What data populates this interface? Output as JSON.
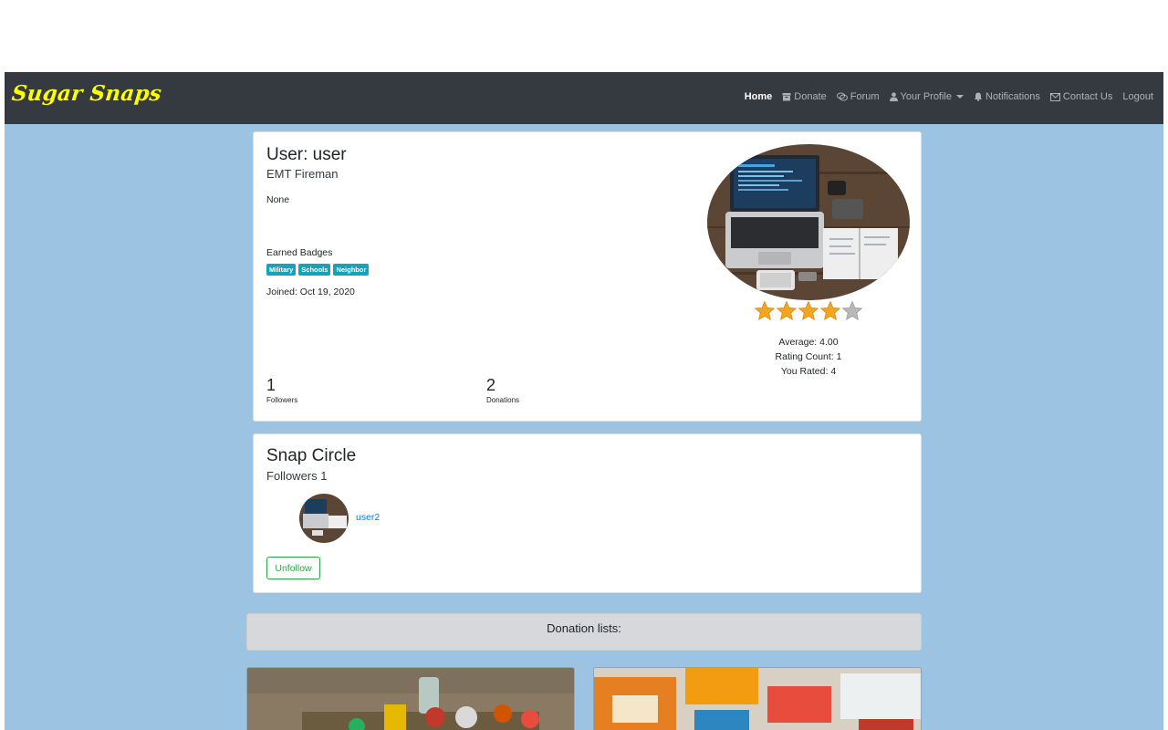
{
  "brand": "Sugar Snaps",
  "nav": {
    "home": "Home",
    "donate": "Donate",
    "forum": "Forum",
    "profile": "Your Profile",
    "notifications": "Notifications",
    "contact": "Contact Us",
    "logout": "Logout"
  },
  "profile": {
    "title": "User: user",
    "subtitle": "EMT Fireman",
    "bio": "None",
    "badges_label": "Earned Badges",
    "badges": [
      "Military",
      "Schools",
      "Neighbor"
    ],
    "joined": "Joined: Oct 19, 2020",
    "followers_count": "1",
    "followers_label": "Followers",
    "donations_count": "2",
    "donations_label": "Donations",
    "stars_filled": 4,
    "stars_total": 5,
    "average": "Average: 4.00",
    "rating_count": "Rating Count: 1",
    "you_rated": "You Rated: 4"
  },
  "snap_circle": {
    "title": "Snap Circle",
    "subtitle": "Followers 1",
    "follower_name": "user2",
    "unfollow_label": "Unfollow"
  },
  "donations": {
    "header": "Donation lists:"
  },
  "colors": {
    "navbar": "#343a40",
    "brand": "#ffff00",
    "page_bg": "#9dc3e2",
    "badge": "#17a2b8",
    "link": "#007bff",
    "success": "#28a745"
  }
}
